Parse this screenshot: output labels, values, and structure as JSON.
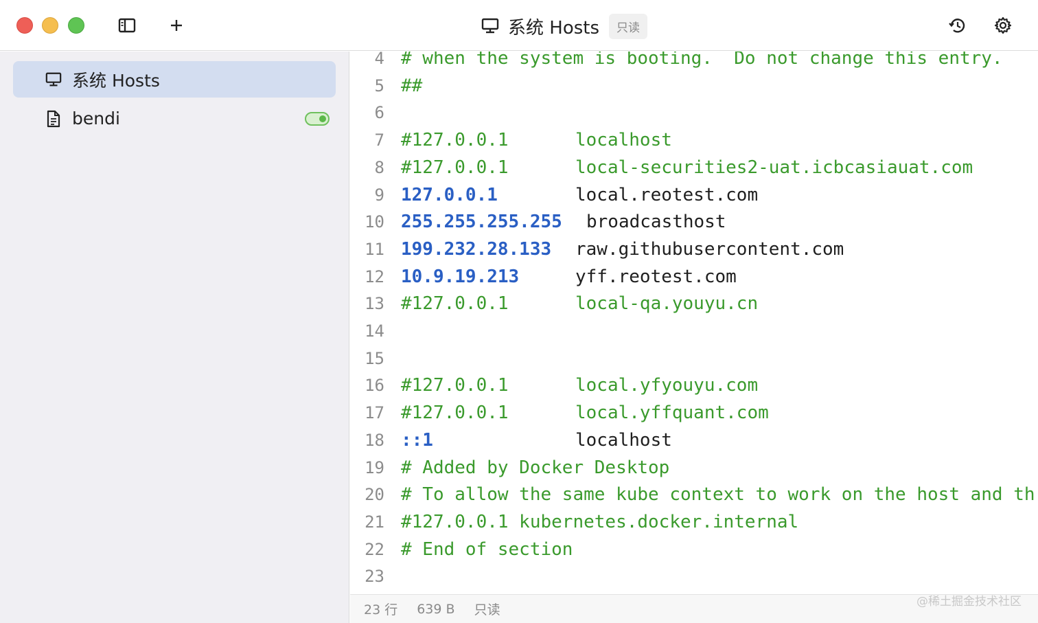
{
  "window": {
    "title": "系统 Hosts",
    "badge": "只读"
  },
  "toolbar": {
    "sidebar_toggle_icon": "sidebar-icon",
    "add_icon": "plus-icon",
    "history_icon": "history-icon",
    "settings_icon": "gear-icon"
  },
  "sidebar": {
    "items": [
      {
        "label": "系统 Hosts",
        "icon": "monitor-icon",
        "active": true
      },
      {
        "label": "bendi",
        "icon": "document-icon",
        "enabled": true
      }
    ]
  },
  "editor": {
    "lines": [
      {
        "n": "4",
        "text": "# when the system is booting.  Do not change this entry."
      },
      {
        "n": "5",
        "text": "##"
      },
      {
        "n": "6",
        "text": ""
      },
      {
        "n": "7",
        "ip": "#127.0.0.1",
        "host": "localhost",
        "comment": true
      },
      {
        "n": "8",
        "ip": "#127.0.0.1",
        "host": "local-securities2-uat.icbcasiauat.com",
        "comment": true
      },
      {
        "n": "9",
        "ip": "127.0.0.1",
        "host": "local.reotest.com"
      },
      {
        "n": "10",
        "ip": "255.255.255.255",
        "host": "broadcasthost"
      },
      {
        "n": "11",
        "ip": "199.232.28.133",
        "host": "raw.githubusercontent.com"
      },
      {
        "n": "12",
        "ip": "10.9.19.213",
        "host": "yff.reotest.com"
      },
      {
        "n": "13",
        "ip": "#127.0.0.1",
        "host": "local-qa.youyu.cn",
        "comment": true
      },
      {
        "n": "14",
        "text": ""
      },
      {
        "n": "15",
        "text": ""
      },
      {
        "n": "16",
        "ip": "#127.0.0.1",
        "host": "local.yfyouyu.com",
        "comment": true
      },
      {
        "n": "17",
        "ip": "#127.0.0.1",
        "host": "local.yffquant.com",
        "comment": true
      },
      {
        "n": "18",
        "ip": "::1",
        "host": "localhost"
      },
      {
        "n": "19",
        "text": "# Added by Docker Desktop"
      },
      {
        "n": "20",
        "text": "# To allow the same kube context to work on the host and th"
      },
      {
        "n": "21",
        "text": "#127.0.0.1 kubernetes.docker.internal"
      },
      {
        "n": "22",
        "text": "# End of section"
      },
      {
        "n": "23",
        "text": ""
      }
    ]
  },
  "statusbar": {
    "lines": "23 行",
    "size": "639 B",
    "mode": "只读"
  },
  "watermark": "@稀土掘金技术社区",
  "colors": {
    "comment": "#3a9a2c",
    "ip": "#2a5fc4",
    "active_item": "#d3ddf0",
    "toggle_on": "#5cb84a"
  }
}
